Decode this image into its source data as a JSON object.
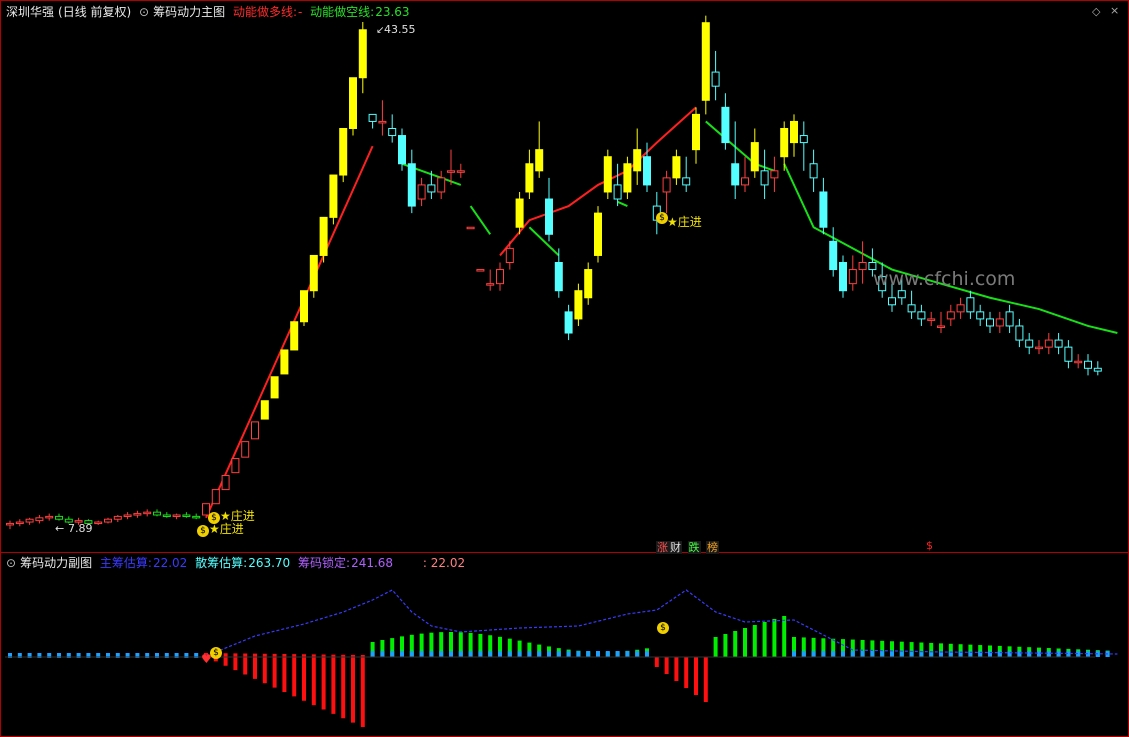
{
  "main_panel": {
    "stock_name": "深圳华强",
    "period_mode": "(日线 前复权)",
    "indicator_name": "筹码动力主图",
    "long_line_label": "动能做多线:",
    "long_line_value": "-",
    "short_line_label": "动能做空线:",
    "short_line_value": "23.63",
    "high_marker": "43.55",
    "low_marker": "7.89",
    "signal_label": "★庄进",
    "watermark": "www.cfchi.com",
    "tags": [
      "涨",
      "财",
      "跌",
      "榜"
    ],
    "bottom_right_marker": "$"
  },
  "sub_panel": {
    "indicator_name": "筹码动力副图",
    "main_estimate_label": "主筹估算:",
    "main_estimate_value": "22.02",
    "scatter_estimate_label": "散筹估算:",
    "scatter_estimate_value": "263.70",
    "lock_label": "筹码锁定:",
    "lock_value": "241.68",
    "extra_value": ": 22.02"
  },
  "colors": {
    "bg": "#000000",
    "border": "#b00000",
    "up_candle": "#ffff00",
    "down_candle": "#54ffff",
    "small_up": "#ff4040",
    "long_line": "#ff2020",
    "short_line": "#18e018",
    "green_bar": "#00ee00",
    "red_bar": "#ff1010",
    "blue_bar": "#1ea0ff",
    "dashed_line": "#3a3aff"
  },
  "chart_data": {
    "type": "candlestick",
    "series": [
      {
        "name": "price",
        "values": [
          [
            7.9,
            8.2,
            7.6,
            8.0
          ],
          [
            8.0,
            8.3,
            7.8,
            8.1
          ],
          [
            8.1,
            8.4,
            7.9,
            8.3
          ],
          [
            8.2,
            8.6,
            8.0,
            8.4
          ],
          [
            8.4,
            8.7,
            8.2,
            8.5
          ],
          [
            8.5,
            8.7,
            8.2,
            8.3
          ],
          [
            8.3,
            8.5,
            8.0,
            8.1
          ],
          [
            8.1,
            8.4,
            7.9,
            8.2
          ],
          [
            8.2,
            8.3,
            7.9,
            8.0
          ],
          [
            8.0,
            8.2,
            7.89,
            8.1
          ],
          [
            8.1,
            8.4,
            8.0,
            8.3
          ],
          [
            8.3,
            8.6,
            8.1,
            8.5
          ],
          [
            8.5,
            8.8,
            8.3,
            8.6
          ],
          [
            8.6,
            8.9,
            8.4,
            8.7
          ],
          [
            8.7,
            9.0,
            8.5,
            8.8
          ],
          [
            8.8,
            9.0,
            8.5,
            8.6
          ],
          [
            8.6,
            8.8,
            8.4,
            8.5
          ],
          [
            8.5,
            8.7,
            8.3,
            8.6
          ],
          [
            8.6,
            8.8,
            8.4,
            8.5
          ],
          [
            8.5,
            8.7,
            8.3,
            8.4
          ],
          [
            8.6,
            9.4,
            8.6,
            9.4
          ],
          [
            9.4,
            10.4,
            9.4,
            10.4
          ],
          [
            10.4,
            11.4,
            10.4,
            11.4
          ],
          [
            11.6,
            12.6,
            11.6,
            12.6
          ],
          [
            12.7,
            13.8,
            12.7,
            13.8
          ],
          [
            14.0,
            15.2,
            14.0,
            15.2
          ],
          [
            15.4,
            16.7,
            15.4,
            16.7
          ],
          [
            16.9,
            18.4,
            16.9,
            18.4
          ],
          [
            18.6,
            20.3,
            18.6,
            20.3
          ],
          [
            20.3,
            22.3,
            20.3,
            22.3
          ],
          [
            22.3,
            24.5,
            22.0,
            24.5
          ],
          [
            24.5,
            27.0,
            24.0,
            27.0
          ],
          [
            27.0,
            29.7,
            26.5,
            29.7
          ],
          [
            29.7,
            32.7,
            29.2,
            32.7
          ],
          [
            32.7,
            36.0,
            32.2,
            36.0
          ],
          [
            36.0,
            39.6,
            35.5,
            39.6
          ],
          [
            39.6,
            43.55,
            38.5,
            43.0
          ],
          [
            37.0,
            37.0,
            36.0,
            36.5
          ],
          [
            36.5,
            38.0,
            35.5,
            36.5
          ],
          [
            36.0,
            37.0,
            35.0,
            35.5
          ],
          [
            35.5,
            36.0,
            33.0,
            33.5
          ],
          [
            33.5,
            34.5,
            30.0,
            30.5
          ],
          [
            31.0,
            32.5,
            30.5,
            32.0
          ],
          [
            32.0,
            33.0,
            31.0,
            31.5
          ],
          [
            31.5,
            33.0,
            31.0,
            32.5
          ],
          [
            33.0,
            34.5,
            32.0,
            33.0
          ],
          [
            33.0,
            33.5,
            32.5,
            33.0
          ],
          [
            29.0,
            29.0,
            29.0,
            29.0
          ],
          [
            26.0,
            26.0,
            26.0,
            26.0
          ],
          [
            25.0,
            26.0,
            24.5,
            25.0
          ],
          [
            25.0,
            26.5,
            24.5,
            26.0
          ],
          [
            26.5,
            28.0,
            26.0,
            27.5
          ],
          [
            29.0,
            31.5,
            28.5,
            31.0
          ],
          [
            31.5,
            34.5,
            31.0,
            33.5
          ],
          [
            33.0,
            36.5,
            32.5,
            34.5
          ],
          [
            31.0,
            32.5,
            28.0,
            28.5
          ],
          [
            26.5,
            27.5,
            24.0,
            24.5
          ],
          [
            23.0,
            23.5,
            21.0,
            21.5
          ],
          [
            22.5,
            25.0,
            22.0,
            24.5
          ],
          [
            24.0,
            26.5,
            23.5,
            26.0
          ],
          [
            27.0,
            30.5,
            26.5,
            30.0
          ],
          [
            31.5,
            34.5,
            31.0,
            34.0
          ],
          [
            32.0,
            33.5,
            30.5,
            31.0
          ],
          [
            31.5,
            34.0,
            31.0,
            33.5
          ],
          [
            33.0,
            36.0,
            32.0,
            34.5
          ],
          [
            34.0,
            35.0,
            31.5,
            32.0
          ],
          [
            30.5,
            31.5,
            28.5,
            29.5
          ],
          [
            31.5,
            33.0,
            30.0,
            32.5
          ],
          [
            32.5,
            34.5,
            32.0,
            34.0
          ],
          [
            32.5,
            34.0,
            31.5,
            32.0
          ],
          [
            34.5,
            37.5,
            33.5,
            37.0
          ],
          [
            38.0,
            44.0,
            37.0,
            43.5
          ],
          [
            40.0,
            41.5,
            38.0,
            39.0
          ],
          [
            37.5,
            38.5,
            34.5,
            35.0
          ],
          [
            33.5,
            36.5,
            31.0,
            32.0
          ],
          [
            32.0,
            34.0,
            31.5,
            32.5
          ],
          [
            33.0,
            36.0,
            32.5,
            35.0
          ],
          [
            33.0,
            34.5,
            31.0,
            32.0
          ],
          [
            32.5,
            34.0,
            31.5,
            33.0
          ],
          [
            34.0,
            36.5,
            33.0,
            36.0
          ],
          [
            35.0,
            37.0,
            34.0,
            36.5
          ],
          [
            35.5,
            36.5,
            33.0,
            35.0
          ],
          [
            33.5,
            34.5,
            31.5,
            32.5
          ],
          [
            31.5,
            32.5,
            28.5,
            29.0
          ],
          [
            28.0,
            29.0,
            25.5,
            26.0
          ],
          [
            26.5,
            27.0,
            24.0,
            24.5
          ],
          [
            25.0,
            27.0,
            24.5,
            26.0
          ],
          [
            26.0,
            28.0,
            25.0,
            26.5
          ],
          [
            26.5,
            27.5,
            25.5,
            26.0
          ],
          [
            25.5,
            26.5,
            24.0,
            24.5
          ],
          [
            24.0,
            25.0,
            23.0,
            23.5
          ],
          [
            24.5,
            25.5,
            23.5,
            24.0
          ],
          [
            23.5,
            24.5,
            22.5,
            23.0
          ],
          [
            23.0,
            23.5,
            22.0,
            22.5
          ],
          [
            22.5,
            23.0,
            22.0,
            22.5
          ],
          [
            22.0,
            23.0,
            21.5,
            22.0
          ],
          [
            22.5,
            23.5,
            22.0,
            23.0
          ],
          [
            23.0,
            24.0,
            22.5,
            23.5
          ],
          [
            24.0,
            24.5,
            22.5,
            23.0
          ],
          [
            23.0,
            23.5,
            22.0,
            22.5
          ],
          [
            22.5,
            23.0,
            21.5,
            22.0
          ],
          [
            22.0,
            23.0,
            21.5,
            22.5
          ],
          [
            23.0,
            23.5,
            21.5,
            22.0
          ],
          [
            22.0,
            22.5,
            20.5,
            21.0
          ],
          [
            21.0,
            21.5,
            20.0,
            20.5
          ],
          [
            20.5,
            21.0,
            20.0,
            20.5
          ],
          [
            20.5,
            21.5,
            20.0,
            21.0
          ],
          [
            21.0,
            21.5,
            20.0,
            20.5
          ],
          [
            20.5,
            21.0,
            19.0,
            19.5
          ],
          [
            19.5,
            20.0,
            19.0,
            19.5
          ],
          [
            19.5,
            20.0,
            18.5,
            19.0
          ],
          [
            19.0,
            19.5,
            18.5,
            18.8
          ]
        ]
      }
    ],
    "y_range": [
      7.89,
      43.55
    ]
  }
}
